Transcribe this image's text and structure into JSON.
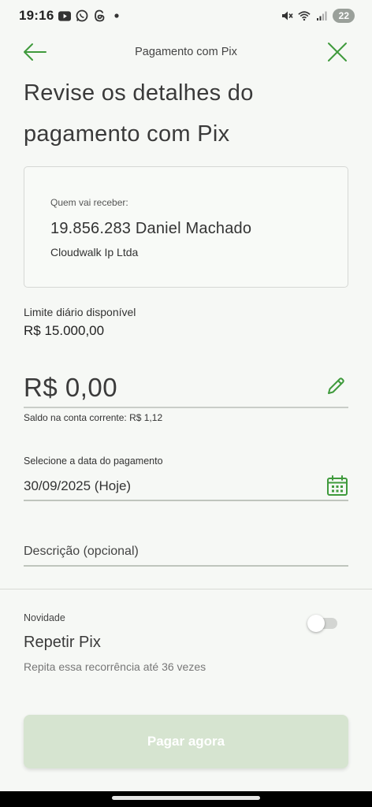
{
  "status_bar": {
    "time": "19:16",
    "battery": "22",
    "icons": [
      "youtube-icon",
      "whatsapp-icon",
      "threads-icon",
      "dot-icon",
      "mute-icon",
      "wifi-icon",
      "signal-icon",
      "battery-icon"
    ]
  },
  "header": {
    "title": "Pagamento com Pix",
    "back_icon": "arrow-left-icon",
    "close_icon": "close-icon"
  },
  "page": {
    "title_line1": "Revise os detalhes do",
    "title_line2": "pagamento com Pix"
  },
  "recipient": {
    "label": "Quem vai receber:",
    "name": "19.856.283 Daniel Machado",
    "institution": "Cloudwalk Ip Ltda"
  },
  "limit": {
    "label": "Limite diário disponível",
    "value": "R$ 15.000,00"
  },
  "amount": {
    "value": "R$ 0,00",
    "balance_text": "Saldo na conta corrente: R$ 1,12",
    "edit_icon": "pencil-icon"
  },
  "payment_date": {
    "label": "Selecione a data do pagamento",
    "value": "30/09/2025 (Hoje)",
    "icon": "calendar-icon"
  },
  "description": {
    "placeholder": "Descrição (opcional)"
  },
  "repeat": {
    "badge": "Novidade",
    "title": "Repetir Pix",
    "subtitle": "Repita essa recorrência até 36 vezes",
    "toggle_on": false
  },
  "actions": {
    "pay_label": "Pagar agora"
  },
  "colors": {
    "accent": "#3f9a3c",
    "background": "#f6f8f5",
    "button_disabled": "#d6e4d0"
  }
}
